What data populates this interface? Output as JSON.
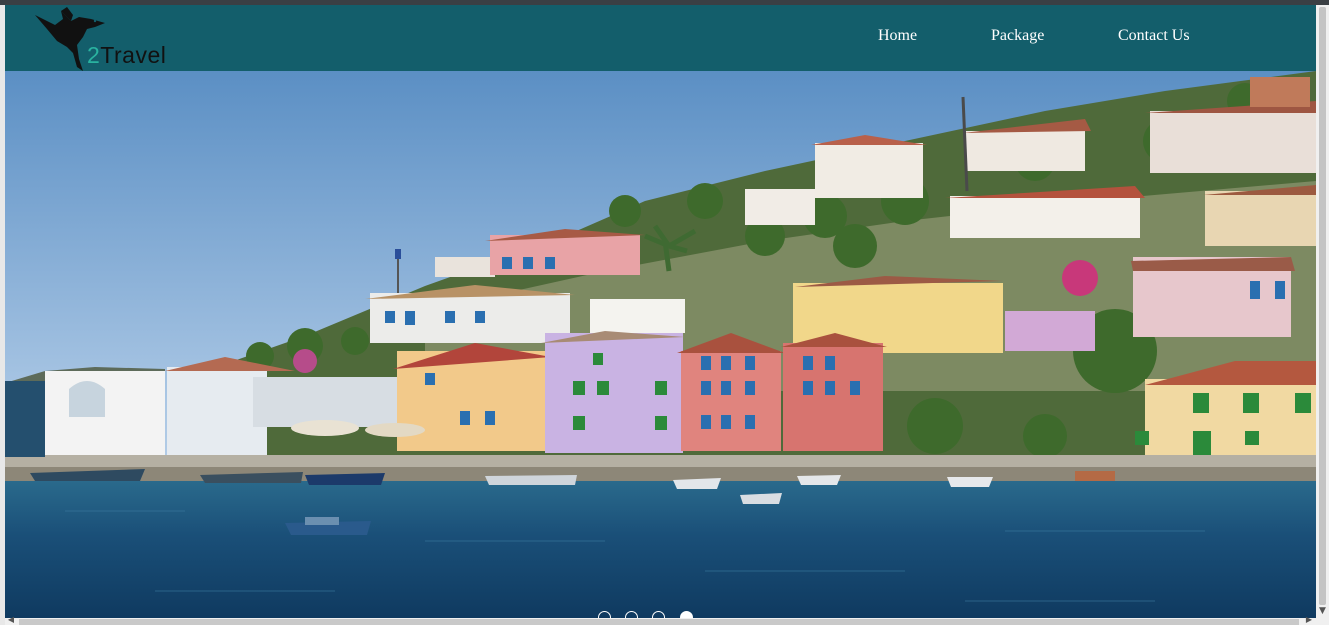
{
  "brand": {
    "prefix": "2",
    "name": "Travel"
  },
  "nav": {
    "items": [
      {
        "label": "Home"
      },
      {
        "label": "Package"
      },
      {
        "label": "Contact Us"
      }
    ]
  },
  "carousel": {
    "slide_count": 4,
    "active_index": 3
  },
  "colors": {
    "navbar": "#135e6b",
    "brand_accent": "#2ab2a0",
    "sky_top": "#5b8fc4",
    "sea": "#15456b"
  },
  "icons": {
    "logo": "bird-icon",
    "scroll_down": "chevron-down-icon",
    "scroll_left": "chevron-left-icon",
    "scroll_right": "chevron-right-icon"
  }
}
